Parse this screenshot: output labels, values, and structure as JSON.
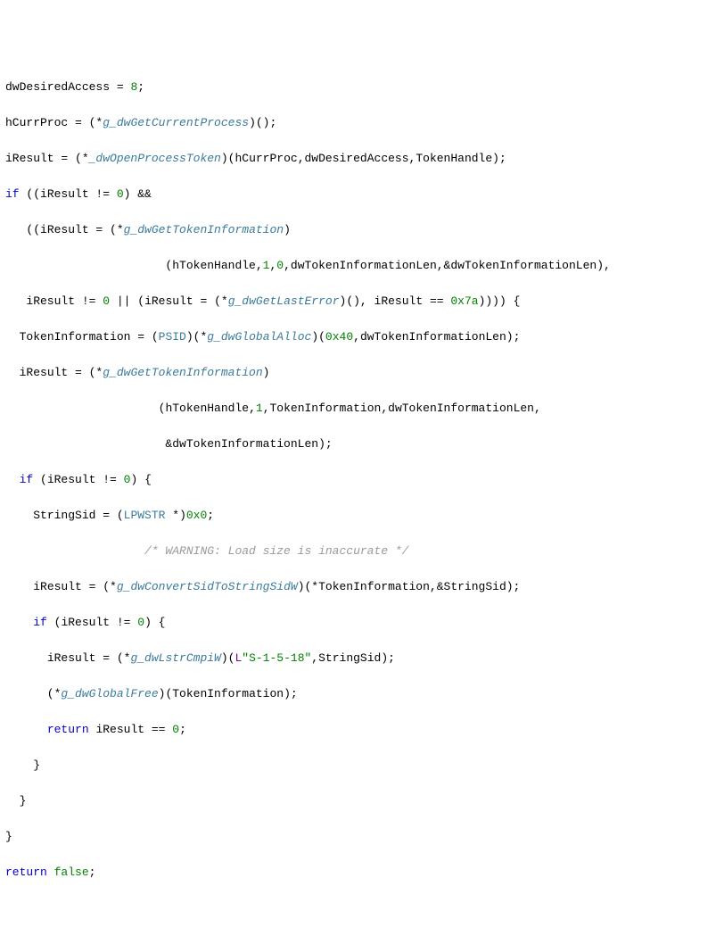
{
  "code": {
    "l1": {
      "a": "dwDesiredAccess",
      "b": " = ",
      "c": "8",
      "d": ";"
    },
    "l2": {
      "a": "hCurrProc",
      "b": " = (*",
      "c": "g_dwGetCurrentProcess",
      "d": ")();"
    },
    "l3": {
      "a": "iResult",
      "b": " = (*",
      "c": "_dwOpenProcessToken",
      "d": ")(",
      "e": "hCurrProc",
      "f": ",",
      "g": "dwDesiredAccess",
      "h": ",",
      "i": "TokenHandle",
      "j": ");"
    },
    "l4": {
      "a": "if",
      "b": " ((",
      "c": "iResult",
      "d": " != ",
      "e": "0",
      "f": ") &&"
    },
    "l5": {
      "a": "   ((",
      "b": "iResult",
      "c": " = (*",
      "d": "g_dwGetTokenInformation",
      "e": ")"
    },
    "l6": {
      "a": "                       (",
      "b": "hTokenHandle",
      "c": ",",
      "d": "1",
      "e": ",",
      "f": "0",
      "g": ",",
      "h": "dwTokenInformationLen",
      "i": ",&",
      "j": "dwTokenInformationLen",
      "k": "),"
    },
    "l7": {
      "a": "   ",
      "b": "iResult",
      "c": " != ",
      "d": "0",
      "e": " || (",
      "f": "iResult",
      "g": " = (*",
      "h": "g_dwGetLastError",
      "i": ")(), ",
      "j": "iResult",
      "k": " == ",
      "l": "0x7a",
      "m": ")))) {"
    },
    "l8": {
      "a": "  ",
      "b": "TokenInformation",
      "c": " = (",
      "d": "PSID",
      "e": ")(*",
      "f": "g_dwGlobalAlloc",
      "g": ")(",
      "h": "0x40",
      "i": ",",
      "j": "dwTokenInformationLen",
      "k": ");"
    },
    "l9": {
      "a": "  ",
      "b": "iResult",
      "c": " = (*",
      "d": "g_dwGetTokenInformation",
      "e": ")"
    },
    "l10": {
      "a": "                      (",
      "b": "hTokenHandle",
      "c": ",",
      "d": "1",
      "e": ",",
      "f": "TokenInformation",
      "g": ",",
      "h": "dwTokenInformationLen",
      "i": ","
    },
    "l11": {
      "a": "                       &",
      "b": "dwTokenInformationLen",
      "c": ");"
    },
    "l12": {
      "a": "  ",
      "b": "if",
      "c": " (",
      "d": "iResult",
      "e": " != ",
      "f": "0",
      "g": ") {"
    },
    "l13": {
      "a": "    ",
      "b": "StringSid",
      "c": " = (",
      "d": "LPWSTR",
      "e": " *)",
      "f": "0x0",
      "g": ";"
    },
    "l14": {
      "a": "                    ",
      "b": "/* WARNING: Load size is inaccurate */"
    },
    "l15": {
      "a": "    ",
      "b": "iResult",
      "c": " = (*",
      "d": "g_dwConvertSidToStringSidW",
      "e": ")(*",
      "f": "TokenInformation",
      "g": ",&",
      "h": "StringSid",
      "i": ");"
    },
    "l16": {
      "a": "    ",
      "b": "if",
      "c": " (",
      "d": "iResult",
      "e": " != ",
      "f": "0",
      "g": ") {"
    },
    "l17": {
      "a": "      ",
      "b": "iResult",
      "c": " = (*",
      "d": "g_dwLstrCmpiW",
      "e": ")(",
      "f": "L",
      "g": "\"S-1-5-18\"",
      "h": ",",
      "i": "StringSid",
      "j": ");"
    },
    "l18": {
      "a": "      (*",
      "b": "g_dwGlobalFree",
      "c": ")(",
      "d": "TokenInformation",
      "e": ");"
    },
    "l19": {
      "a": "      ",
      "b": "return",
      "c": " ",
      "d": "iResult",
      "e": " == ",
      "f": "0",
      "g": ";"
    },
    "l20": {
      "a": "    }"
    },
    "l21": {
      "a": "  }"
    },
    "l22": {
      "a": "}"
    },
    "l23": {
      "a": "return",
      "b": " ",
      "c": "false",
      "d": ";"
    }
  }
}
